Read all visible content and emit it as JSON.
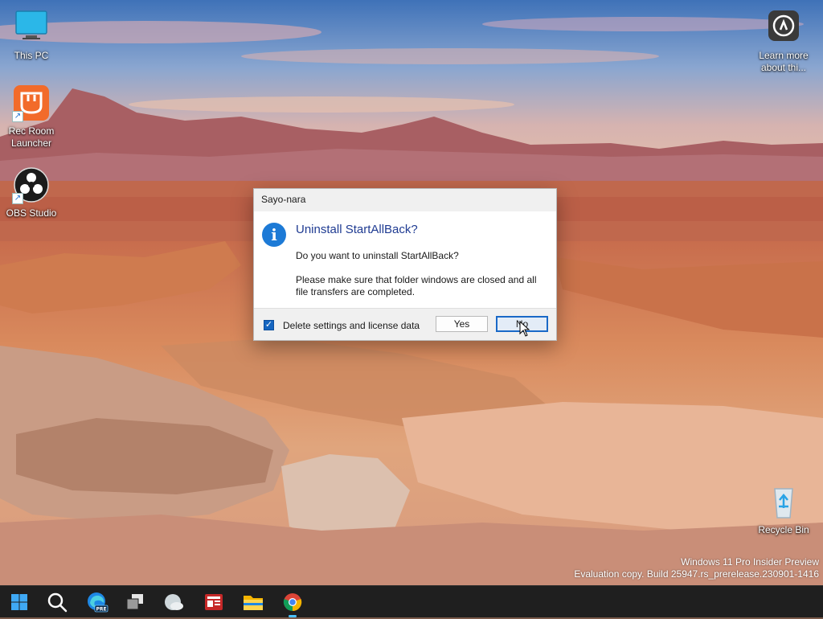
{
  "desktop": {
    "icons": [
      {
        "label": "This PC",
        "icon": "monitor-icon"
      },
      {
        "label": "Rec Room Launcher",
        "icon": "rec-room-icon"
      },
      {
        "label": "OBS Studio",
        "icon": "obs-icon"
      },
      {
        "label": "Learn more about thi...",
        "icon": "learn-more-icon"
      },
      {
        "label": "Recycle Bin",
        "icon": "recycle-bin-icon"
      }
    ]
  },
  "dialog": {
    "title": "Sayo-nara",
    "heading": "Uninstall StartAllBack?",
    "question": "Do you want to uninstall StartAllBack?",
    "message": "Please make sure that folder windows are closed and all file transfers are completed.",
    "checkbox_label": "Delete settings and license data",
    "checkbox_checked": true,
    "yes_label": "Yes",
    "no_label": "No",
    "heading_color": "#1f3b92",
    "accent": "#1a69c7"
  },
  "watermark": {
    "line1": "Windows 11 Pro Insider Preview",
    "line2": "Evaluation copy. Build 25947.rs_prerelease.230901-1416"
  },
  "taskbar": {
    "items": [
      {
        "name": "start",
        "icon": "windows-logo-icon"
      },
      {
        "name": "search",
        "icon": "search-icon"
      },
      {
        "name": "edge-pre",
        "icon": "edge-icon",
        "badge": "PRE"
      },
      {
        "name": "task-view",
        "icon": "task-view-icon"
      },
      {
        "name": "widgets",
        "icon": "weather-icon"
      },
      {
        "name": "news",
        "icon": "news-icon"
      },
      {
        "name": "file-explorer",
        "icon": "folder-icon"
      },
      {
        "name": "chrome",
        "icon": "chrome-icon"
      }
    ]
  }
}
